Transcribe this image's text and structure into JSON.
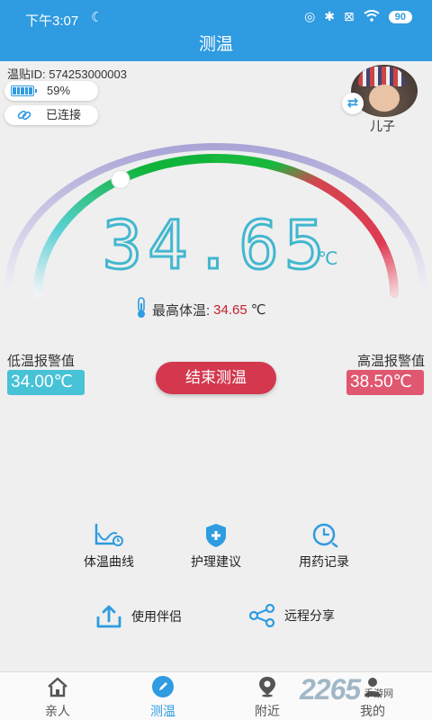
{
  "status_bar": {
    "time": "下午3:07",
    "battery": "90"
  },
  "header": {
    "title": "测温"
  },
  "device": {
    "id_text": "温贴ID: 574253000003",
    "battery_percent": "59%",
    "connection_status": "已连接"
  },
  "profile": {
    "name": "儿子"
  },
  "gauge": {
    "current_temp": "34.65",
    "unit": "℃",
    "level_fraction": 0.32
  },
  "max_temp": {
    "label": "最高体温:",
    "value": "34.65",
    "unit": "℃"
  },
  "alarms": {
    "low_label": "低温报警值",
    "low_value": "34.00℃",
    "high_label": "高温报警值",
    "high_value": "38.50℃"
  },
  "end_button": "结束测温",
  "features": {
    "curve": "体温曲线",
    "care": "护理建议",
    "medication": "用药记录"
  },
  "actions": {
    "companion": "使用伴侣",
    "share": "远程分享"
  },
  "tabs": {
    "family": "亲人",
    "temp": "测温",
    "nearby": "附近",
    "mine": "我的"
  },
  "watermark": {
    "number": "2265",
    "text": "手游网"
  },
  "colors": {
    "primary": "#2f9be0",
    "cyan": "#47c2d6",
    "alert_red": "#d3384e"
  }
}
